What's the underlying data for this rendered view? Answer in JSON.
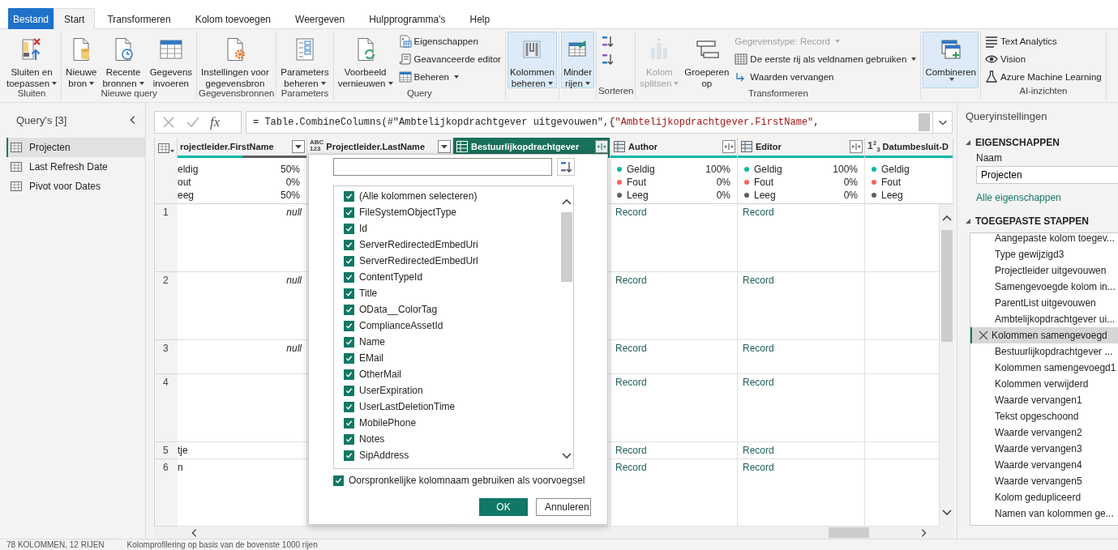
{
  "tabs": [
    {
      "label": "Bestand",
      "kind": "file",
      "selected": false
    },
    {
      "label": "Start",
      "kind": "tab",
      "selected": true
    },
    {
      "label": "Transformeren",
      "kind": "tab",
      "selected": false
    },
    {
      "label": "Kolom toevoegen",
      "kind": "tab",
      "selected": false
    },
    {
      "label": "Weergeven",
      "kind": "tab",
      "selected": false
    },
    {
      "label": "Hulpprogramma's",
      "kind": "tab",
      "selected": false
    },
    {
      "label": "Help",
      "kind": "tab",
      "selected": false
    }
  ],
  "ribbon": [
    {
      "label": "Sluiten",
      "items": [
        {
          "kind": "large",
          "lines": [
            "Sluiten en",
            "toepassen"
          ],
          "dropdown": true,
          "highlighted": false,
          "disabled": false
        }
      ]
    },
    {
      "label": "Nieuwe query",
      "items": [
        {
          "kind": "large",
          "lines": [
            "Nieuwe",
            "bron"
          ],
          "dropdown": true,
          "highlighted": false,
          "disabled": false
        },
        {
          "kind": "large",
          "lines": [
            "Recente",
            "bronnen"
          ],
          "dropdown": true,
          "highlighted": false,
          "disabled": false
        },
        {
          "kind": "large",
          "lines": [
            "Gegevens",
            "invoeren"
          ],
          "dropdown": false,
          "highlighted": false,
          "disabled": false
        }
      ]
    },
    {
      "label": "Gegevensbronnen",
      "items": [
        {
          "kind": "large",
          "lines": [
            "Instellingen voor",
            "gegevensbron"
          ],
          "dropdown": false,
          "highlighted": false,
          "disabled": false
        }
      ]
    },
    {
      "label": "Parameters",
      "items": [
        {
          "kind": "large",
          "lines": [
            "Parameters",
            "beheren"
          ],
          "dropdown": true,
          "highlighted": false,
          "disabled": false
        }
      ]
    },
    {
      "label": "Query",
      "items": [
        {
          "kind": "large",
          "lines": [
            "Voorbeeld",
            "vernieuwen"
          ],
          "dropdown": true,
          "highlighted": false,
          "disabled": false
        },
        {
          "kind": "small",
          "label": "Eigenschappen",
          "dropdown": false,
          "highlighted": false,
          "disabled": false
        },
        {
          "kind": "small",
          "label": "Geavanceerde editor",
          "dropdown": false,
          "highlighted": false,
          "disabled": false
        },
        {
          "kind": "small",
          "label": "Beheren",
          "dropdown": true,
          "highlighted": false,
          "disabled": false
        }
      ]
    },
    {
      "items": [
        {
          "kind": "large",
          "lines": [
            "Kolommen",
            "beheren"
          ],
          "dropdown": true,
          "highlighted": true,
          "disabled": false
        }
      ]
    },
    {
      "items": [
        {
          "kind": "large",
          "lines": [
            "Minder",
            "rijen"
          ],
          "dropdown": true,
          "highlighted": true,
          "disabled": false
        }
      ]
    },
    {
      "label": "Sorteren",
      "items": [
        {
          "kind": "icon",
          "highlighted": false,
          "disabled": false
        },
        {
          "kind": "icon",
          "highlighted": false,
          "disabled": false
        }
      ]
    },
    {
      "label": "Transformeren",
      "items": [
        {
          "kind": "large",
          "lines": [
            "Kolom",
            "splitsen"
          ],
          "dropdown": true,
          "highlighted": false,
          "disabled": true
        },
        {
          "kind": "large",
          "lines": [
            "Groeperen",
            "op"
          ],
          "dropdown": false,
          "highlighted": false,
          "disabled": false
        },
        {
          "kind": "small",
          "label": "Gegevenstype: Record",
          "dropdown": true,
          "highlighted": false,
          "disabled": true
        },
        {
          "kind": "small",
          "label": "De eerste rij als veldnamen gebruiken",
          "dropdown": true,
          "highlighted": false,
          "disabled": false
        },
        {
          "kind": "small",
          "label": "Waarden vervangen",
          "dropdown": false,
          "highlighted": false,
          "disabled": false
        }
      ]
    },
    {
      "items": [
        {
          "kind": "large",
          "lines": [
            "Combineren"
          ],
          "dropdown": true,
          "highlighted": true,
          "disabled": false
        }
      ]
    },
    {
      "label": "AI-inzichten",
      "items": [
        {
          "kind": "small",
          "label": "Text Analytics",
          "dropdown": false,
          "highlighted": false,
          "disabled": false
        },
        {
          "kind": "small",
          "label": "Vision",
          "dropdown": false,
          "highlighted": false,
          "disabled": false
        },
        {
          "kind": "small",
          "label": "Azure Machine Learning",
          "dropdown": false,
          "highlighted": false,
          "disabled": false
        }
      ]
    }
  ],
  "queries": {
    "title": "Query's [3]",
    "items": [
      {
        "label": "Projecten",
        "selected": true
      },
      {
        "label": "Last Refresh Date",
        "selected": false
      },
      {
        "label": "Pivot voor Dates",
        "selected": false
      }
    ]
  },
  "formula": {
    "fx": "fx",
    "segments": [
      {
        "text": "= Table.CombineColumns(#\"Ambtelijkopdrachtgever uitgevouwen\",{",
        "kind": "code"
      },
      {
        "text": "\"Ambtelijkopdrachtgever.FirstName\"",
        "kind": "string"
      },
      {
        "text": ",",
        "kind": "code"
      }
    ]
  },
  "grid": {
    "columns": [
      {
        "title": "rojectleider.FirstName",
        "control": {
          "kind": "filter"
        },
        "selected": false,
        "quality": {
          "level": 0.5
        },
        "stats": [
          {
            "label": "eldig",
            "value": "50%"
          },
          {
            "label": "out",
            "value": "0%"
          },
          {
            "label": "eeg",
            "value": "50%"
          }
        ]
      },
      {
        "title": "Projectleider.LastName",
        "type": {
          "kind": "any",
          "label": [
            "ABC",
            "123"
          ]
        },
        "control": {
          "kind": "filter"
        },
        "selected": false
      },
      {
        "title": "Bestuurlijkopdrachtgever",
        "type": {
          "kind": "table"
        },
        "control": {
          "kind": "expand"
        },
        "selected": true
      },
      {
        "title": "Author",
        "type": {
          "kind": "table"
        },
        "control": {
          "kind": "expand"
        },
        "selected": false,
        "quality": {
          "level": 1
        },
        "stats": [
          {
            "label": "Geldig",
            "value": "100%",
            "color": "#01b8aa"
          },
          {
            "label": "Fout",
            "value": "0%",
            "color": "#fd625e"
          },
          {
            "label": "Leeg",
            "value": "0%",
            "color": "#5f5f5f"
          }
        ]
      },
      {
        "title": "Editor",
        "type": {
          "kind": "table"
        },
        "control": {
          "kind": "expand"
        },
        "selected": false,
        "quality": {
          "level": 1
        },
        "stats": [
          {
            "label": "Geldig",
            "value": "100%",
            "color": "#01b8aa"
          },
          {
            "label": "Fout",
            "value": "0%",
            "color": "#fd625e"
          },
          {
            "label": "Leeg",
            "value": "0%",
            "color": "#5f5f5f"
          }
        ]
      },
      {
        "title": "Datumbesluit-D",
        "type": {
          "kind": "number",
          "label": "1$^{2}$$_{3}$"
        },
        "selected": false,
        "quality": {
          "level": 1
        },
        "stats": [
          {
            "label": "Geldig",
            "color": "#01b8aa"
          },
          {
            "label": "Fout",
            "color": "#fd625e"
          },
          {
            "label": "Leeg",
            "color": "#5f5f5f"
          }
        ]
      }
    ],
    "rows": [
      {
        "number": "1",
        "cells": [
          {
            "text": "null",
            "kind": "null"
          },
          {},
          {},
          {
            "text": "Record",
            "kind": "record"
          },
          {
            "text": "Record",
            "kind": "record"
          },
          {}
        ]
      },
      {
        "number": "2",
        "cells": [
          {
            "text": "null",
            "kind": "null"
          },
          {},
          {},
          {
            "text": "Record",
            "kind": "record"
          },
          {
            "text": "Record",
            "kind": "record"
          },
          {}
        ]
      },
      {
        "number": "3",
        "cells": [
          {
            "text": "null",
            "kind": "null"
          },
          {},
          {},
          {
            "text": "Record",
            "kind": "record"
          },
          {
            "text": "Record",
            "kind": "record"
          },
          {}
        ]
      },
      {
        "number": "4",
        "cells": [
          {},
          {},
          {},
          {
            "text": "Record",
            "kind": "record"
          },
          {
            "text": "Record",
            "kind": "record"
          },
          {}
        ]
      },
      {
        "number": "5",
        "cells": [
          {
            "text": "tje",
            "kind": "text"
          },
          {},
          {},
          {
            "text": "Record",
            "kind": "record"
          },
          {
            "text": "Record",
            "kind": "record"
          },
          {}
        ]
      },
      {
        "number": "6",
        "cells": [
          {
            "text": "n",
            "kind": "text"
          },
          {},
          {},
          {
            "text": "Record",
            "kind": "record"
          },
          {
            "text": "Record",
            "kind": "record"
          },
          {}
        ]
      }
    ]
  },
  "dialog": {
    "items": [
      {
        "label": "(Alle kolommen selecteren)",
        "checked": true
      },
      {
        "label": "FileSystemObjectType",
        "checked": true
      },
      {
        "label": "Id",
        "checked": true
      },
      {
        "label": "ServerRedirectedEmbedUri",
        "checked": true
      },
      {
        "label": "ServerRedirectedEmbedUrl",
        "checked": true
      },
      {
        "label": "ContentTypeId",
        "checked": true
      },
      {
        "label": "Title",
        "checked": true
      },
      {
        "label": "OData__ColorTag",
        "checked": true
      },
      {
        "label": "ComplianceAssetId",
        "checked": true
      },
      {
        "label": "Name",
        "checked": true
      },
      {
        "label": "EMail",
        "checked": true
      },
      {
        "label": "OtherMail",
        "checked": true
      },
      {
        "label": "UserExpiration",
        "checked": true
      },
      {
        "label": "UserLastDeletionTime",
        "checked": true
      },
      {
        "label": "MobilePhone",
        "checked": true
      },
      {
        "label": "Notes",
        "checked": true
      },
      {
        "label": "SipAddress",
        "checked": true
      }
    ],
    "prefix": {
      "label": "Oorspronkelijke kolomnaam gebruiken als voorvoegsel",
      "checked": true
    },
    "buttons": [
      {
        "label": "OK",
        "kind": "primary"
      },
      {
        "label": "Annuleren",
        "kind": "secondary"
      }
    ]
  },
  "settings": {
    "title": "Queryinstellingen",
    "properties": {
      "heading": "EIGENSCHAPPEN",
      "expanded": true,
      "name_label": "Naam",
      "name_value": "Projecten",
      "link": "Alle eigenschappen"
    },
    "steps": {
      "heading": "TOEGEPASTE STAPPEN",
      "expanded": true,
      "items": [
        {
          "label": "Aangepaste kolom toegev...",
          "selected": false
        },
        {
          "label": "Type gewijzigd3",
          "selected": false
        },
        {
          "label": "Projectleider uitgevouwen",
          "selected": false
        },
        {
          "label": "Samengevoegde kolom in...",
          "selected": false
        },
        {
          "label": "ParentList uitgevouwen",
          "selected": false
        },
        {
          "label": "Ambtelijkopdrachtgever ui...",
          "selected": false
        },
        {
          "label": "Kolommen samengevoegd",
          "selected": true
        },
        {
          "label": "Bestuurlijkopdrachtgever ...",
          "selected": false
        },
        {
          "label": "Kolommen samengevoegd1",
          "selected": false
        },
        {
          "label": "Kolommen verwijderd",
          "selected": false
        },
        {
          "label": "Waarde vervangen1",
          "selected": false
        },
        {
          "label": "Tekst opgeschoond",
          "selected": false
        },
        {
          "label": "Waarde vervangen2",
          "selected": false
        },
        {
          "label": "Waarde vervangen3",
          "selected": false
        },
        {
          "label": "Waarde vervangen4",
          "selected": false
        },
        {
          "label": "Waarde vervangen5",
          "selected": false
        },
        {
          "label": "Kolom gedupliceerd",
          "selected": false
        },
        {
          "label": "Namen van kolommen ge...",
          "selected": false
        }
      ]
    }
  },
  "status_bar": [
    "78 KOLOMMEN, 12 RIJEN",
    "Kolomprofilering op basis van de bovenste 1000 rijen"
  ]
}
